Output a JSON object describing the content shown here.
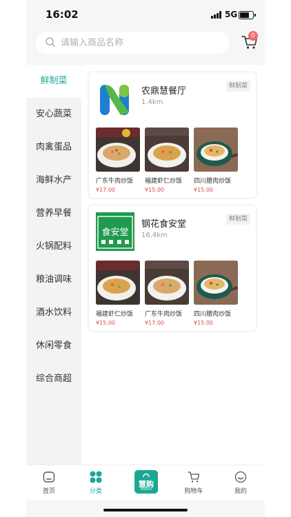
{
  "status": {
    "time": "16:02",
    "network": "5G"
  },
  "search": {
    "placeholder": "请输入商品名称"
  },
  "cart_badge": "0",
  "sidebar": {
    "items": [
      {
        "label": "鲜制菜"
      },
      {
        "label": "安心蔬菜"
      },
      {
        "label": "肉禽蛋品"
      },
      {
        "label": "海鲜水产"
      },
      {
        "label": "营养早餐"
      },
      {
        "label": "火锅配料"
      },
      {
        "label": "粮油调味"
      },
      {
        "label": "酒水饮料"
      },
      {
        "label": "休闲零食"
      },
      {
        "label": "综合商超"
      }
    ],
    "active_index": 0
  },
  "stores": [
    {
      "name": "农鼎慧餐厅",
      "distance": "1.4km",
      "tag": "鲜制菜",
      "logo_icon": "nongding-logo-icon",
      "products": [
        {
          "name": "广东牛肉炒饭",
          "price": "¥17.00",
          "image_icon": "fried-rice-beef-image"
        },
        {
          "name": "福建虾仁炒饭",
          "price": "¥15.00",
          "image_icon": "fried-rice-shrimp-image"
        },
        {
          "name": "四川腊肉炒饭",
          "price": "¥15.00",
          "image_icon": "fried-rice-bacon-image"
        }
      ]
    },
    {
      "name": "钢花食安堂",
      "distance": "16.4km",
      "tag": "鲜制菜",
      "logo_icon": "gangshi-logo-icon",
      "logo_text": "食安堂",
      "products": [
        {
          "name": "福建虾仁炒饭",
          "price": "¥15.00",
          "image_icon": "fried-rice-shrimp-image"
        },
        {
          "name": "广东牛肉炒饭",
          "price": "¥17.00",
          "image_icon": "fried-rice-beef-image"
        },
        {
          "name": "四川腊肉炒饭",
          "price": "¥15.00",
          "image_icon": "fried-rice-bacon-image"
        }
      ]
    }
  ],
  "tabbar": {
    "home": "首页",
    "category": "分类",
    "center": "慧购",
    "center_sub": "HUIGOU",
    "cart": "购物车",
    "mine": "我的",
    "active": "category"
  },
  "colors": {
    "accent": "#1aa894",
    "price": "#e04a4a",
    "badge": "#f26a6a"
  }
}
